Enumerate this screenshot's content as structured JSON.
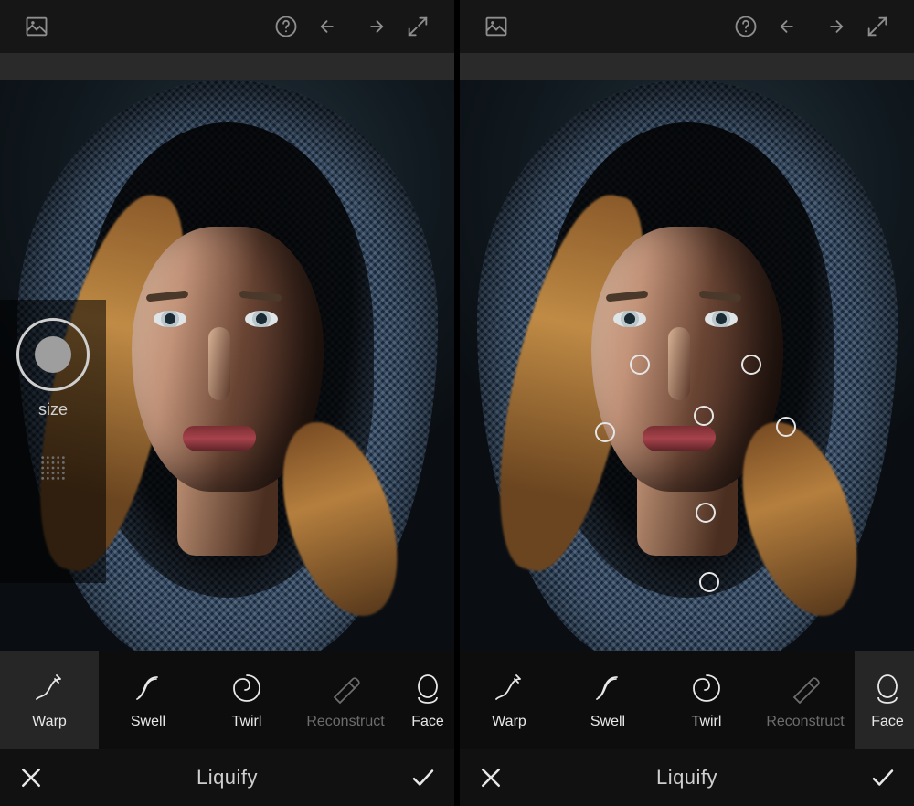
{
  "topbar": {
    "icon_open": "open-image-icon",
    "icon_help": "help-icon",
    "icon_undo": "undo-icon",
    "icon_redo": "redo-icon",
    "icon_fullscreen": "fullscreen-icon"
  },
  "size_panel": {
    "label": "size"
  },
  "tools": [
    {
      "id": "warp",
      "label": "Warp"
    },
    {
      "id": "swell",
      "label": "Swell"
    },
    {
      "id": "twirl",
      "label": "Twirl"
    },
    {
      "id": "reconstruct",
      "label": "Reconstruct"
    },
    {
      "id": "face",
      "label": "Face"
    }
  ],
  "screen1": {
    "selected_tool": "warp"
  },
  "screen2": {
    "selected_tool": "face"
  },
  "bottom": {
    "title": "Liquify",
    "cancel": "cancel",
    "confirm": "confirm"
  }
}
